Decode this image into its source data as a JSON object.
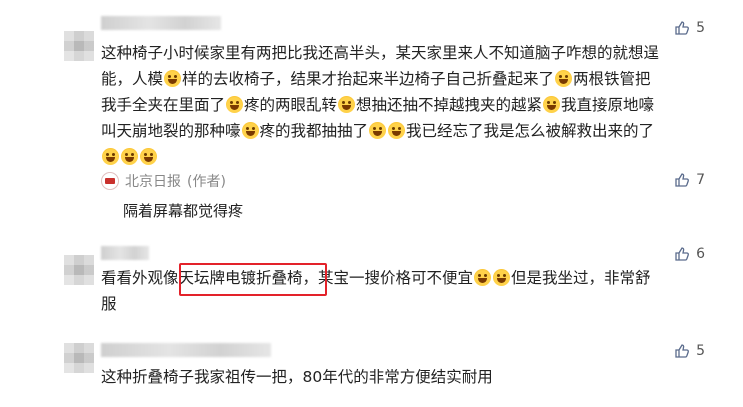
{
  "comments": [
    {
      "likes": "5",
      "lines": [
        "这种椅子小时候家里有两把比我还高半头，某天家里来人不知道脑子咋想的就想逞",
        "能，人模",
        "样的去收椅子，结果才抬起来半边椅子自己折叠起来了",
        "两根铁管把",
        "我手全夹在里面了",
        "疼的两眼乱转",
        "想抽还抽不掉越拽夹的越紧",
        "我直接原地嚎",
        "叫天崩地裂的那种嚎",
        "疼的我都抽抽了",
        "我已经忘了我是怎么被解救出来的了"
      ],
      "reply": {
        "author": "北京日报",
        "author_tag": "(作者)",
        "likes": "7",
        "text": "隔着屏幕都觉得疼"
      }
    },
    {
      "likes": "6",
      "line1_before": "看看外观像",
      "line1_highlight": "天坛牌电镀折叠椅，",
      "line1_after": "某宝一搜价格可不便宜",
      "line1_tail": "但是我坐过，非常舒",
      "line2": "服"
    },
    {
      "likes": "5",
      "text": "这种折叠椅子我家祖传一把，80年代的非常方便结实耐用"
    }
  ],
  "colors": {
    "highlight": "#e3222a",
    "like_icon": "#5a6b8c"
  },
  "icons": {
    "like": "thumbs-up-icon",
    "emoji": "emoji-icon",
    "publisher_logo": "beijing-daily-logo-icon"
  }
}
